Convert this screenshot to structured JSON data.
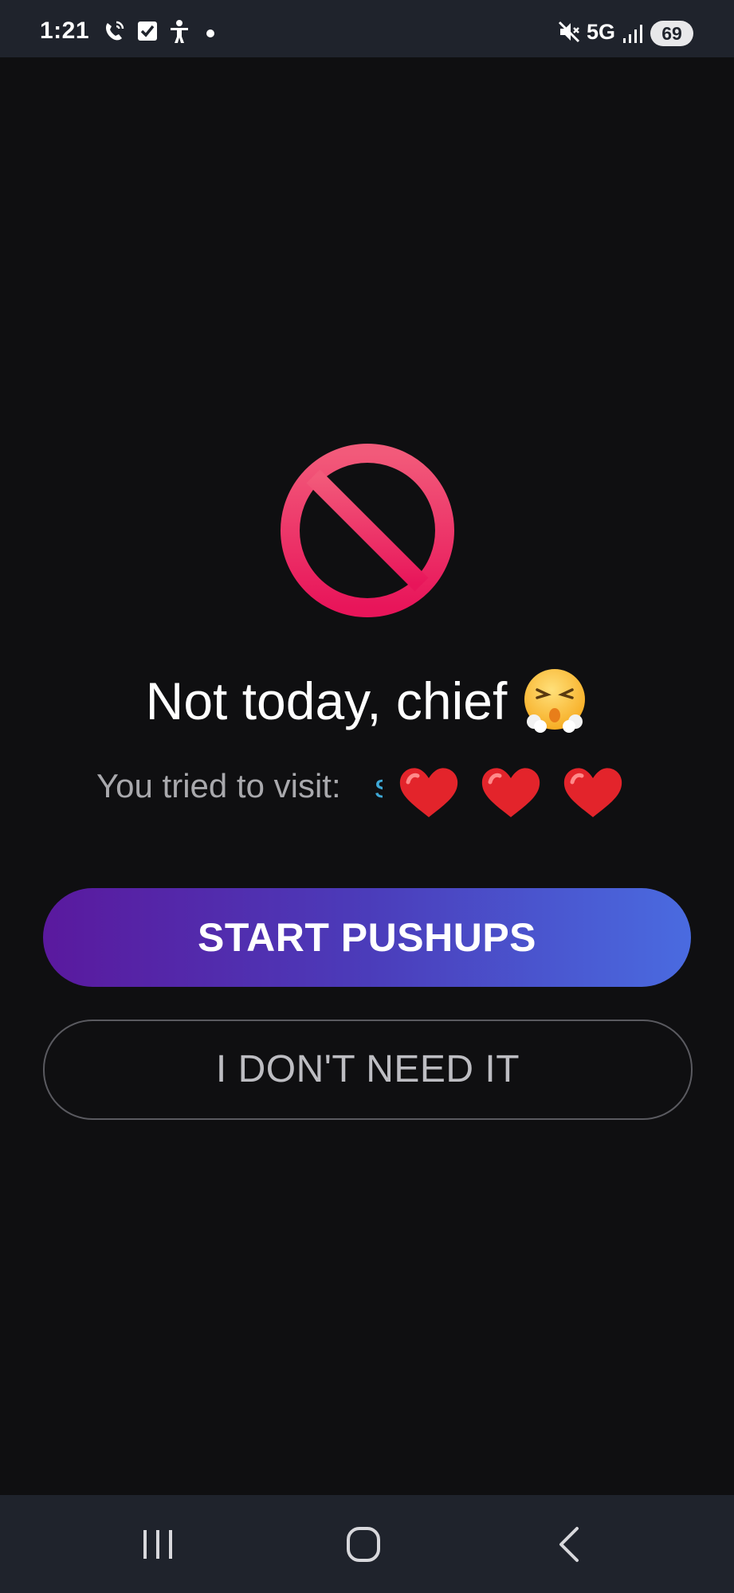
{
  "status_bar": {
    "time": "1:21",
    "network": "5G",
    "battery": "69",
    "icons": [
      "wifi-calling-icon",
      "checkbox-icon",
      "accessibility-icon",
      "notification-dot-icon",
      "mute-icon",
      "signal-icon"
    ]
  },
  "block_screen": {
    "icon": "prohibited-icon",
    "headline": "Not today, chief",
    "headline_emoji": "face-with-steam-icon",
    "visit_label": "You tried to visit:",
    "visit_value": "s",
    "lives": 3,
    "lives_icon": "heart-icon"
  },
  "actions": {
    "primary_label": "START PUSHUPS",
    "secondary_label": "I DON'T NEED IT"
  },
  "nav_bar": {
    "buttons": [
      "recent-apps-icon",
      "home-icon",
      "back-icon"
    ]
  },
  "colors": {
    "background": "#0f0f11",
    "bar": "#1f232c",
    "primary_gradient_start": "#5a199e",
    "primary_gradient_end": "#4a6be0",
    "prohibited_red": "#ee1e5a",
    "heart_red": "#e3242b"
  }
}
